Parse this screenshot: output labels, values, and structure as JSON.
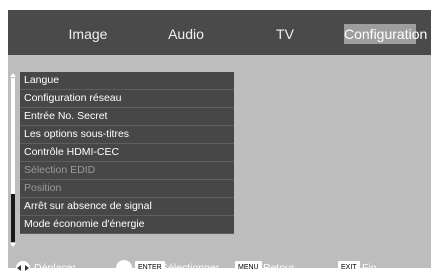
{
  "tabs": {
    "image": "Image",
    "audio": "Audio",
    "tv": "TV",
    "config": "Configuration"
  },
  "menu": {
    "items": [
      {
        "label": "Langue",
        "enabled": true
      },
      {
        "label": "Configuration réseau",
        "enabled": true
      },
      {
        "label": "Entrée No. Secret",
        "enabled": true
      },
      {
        "label": "Les options sous-titres",
        "enabled": true
      },
      {
        "label": "Contrôle HDMI-CEC",
        "enabled": true
      },
      {
        "label": "Sélection EDID",
        "enabled": false
      },
      {
        "label": "Position",
        "enabled": false
      },
      {
        "label": "Arrêt sur absence de signal",
        "enabled": true
      },
      {
        "label": "Mode économie d'énergie",
        "enabled": true
      }
    ]
  },
  "footer": {
    "move_label": "Déplacer",
    "select_key": "ENTER",
    "select_label": "Sélectionner",
    "back_key": "MENU",
    "back_label": "Retour",
    "exit_key": "EXIT",
    "exit_label": "Fin"
  }
}
